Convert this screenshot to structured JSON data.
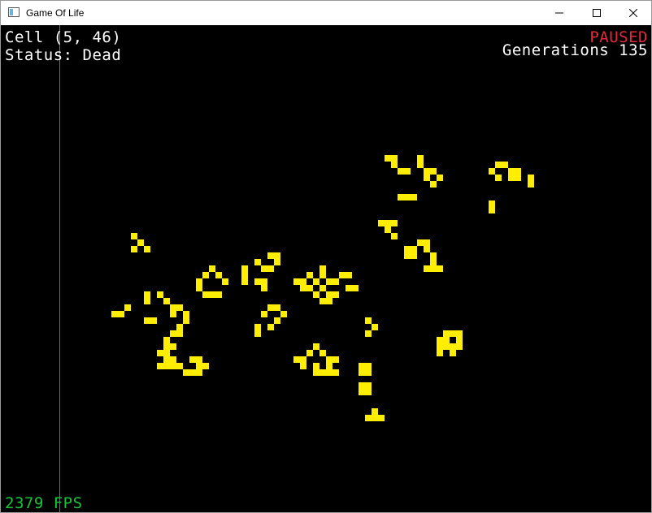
{
  "window": {
    "title": "Game Of Life",
    "controls": [
      "minimize",
      "maximize",
      "close"
    ]
  },
  "hud": {
    "cell_label": "Cell (5, 46)",
    "status_label": "Status: Dead",
    "state": "PAUSED",
    "generations": "Generations 135",
    "fps": "2379 FPS"
  },
  "board": {
    "cell_size_units": 8,
    "live_cell_color": "#ffee00",
    "dead_color": "#000000",
    "live_cells": [
      [
        59,
        20
      ],
      [
        60,
        20
      ],
      [
        64,
        20
      ],
      [
        60,
        21
      ],
      [
        64,
        21
      ],
      [
        61,
        22
      ],
      [
        62,
        22
      ],
      [
        65,
        22
      ],
      [
        66,
        22
      ],
      [
        65,
        23
      ],
      [
        67,
        23
      ],
      [
        66,
        24
      ],
      [
        61,
        26
      ],
      [
        62,
        26
      ],
      [
        63,
        26
      ],
      [
        76,
        21
      ],
      [
        77,
        21
      ],
      [
        75,
        22
      ],
      [
        78,
        22
      ],
      [
        76,
        23
      ],
      [
        78,
        23
      ],
      [
        79,
        22
      ],
      [
        79,
        23
      ],
      [
        81,
        23
      ],
      [
        81,
        24
      ],
      [
        75,
        27
      ],
      [
        75,
        28
      ],
      [
        58,
        30
      ],
      [
        59,
        30
      ],
      [
        60,
        30
      ],
      [
        59,
        31
      ],
      [
        60,
        32
      ],
      [
        64,
        33
      ],
      [
        65,
        33
      ],
      [
        62,
        34
      ],
      [
        63,
        34
      ],
      [
        65,
        34
      ],
      [
        62,
        35
      ],
      [
        63,
        35
      ],
      [
        66,
        35
      ],
      [
        66,
        36
      ],
      [
        65,
        37
      ],
      [
        66,
        37
      ],
      [
        67,
        37
      ],
      [
        20,
        32
      ],
      [
        21,
        33
      ],
      [
        20,
        34
      ],
      [
        22,
        34
      ],
      [
        41,
        35
      ],
      [
        42,
        35
      ],
      [
        39,
        36
      ],
      [
        42,
        36
      ],
      [
        37,
        37
      ],
      [
        40,
        37
      ],
      [
        41,
        37
      ],
      [
        37,
        38
      ],
      [
        37,
        39
      ],
      [
        39,
        39
      ],
      [
        40,
        39
      ],
      [
        40,
        40
      ],
      [
        32,
        37
      ],
      [
        31,
        38
      ],
      [
        33,
        38
      ],
      [
        30,
        39
      ],
      [
        34,
        39
      ],
      [
        30,
        40
      ],
      [
        31,
        41
      ],
      [
        32,
        41
      ],
      [
        33,
        41
      ],
      [
        49,
        37
      ],
      [
        47,
        38
      ],
      [
        49,
        38
      ],
      [
        52,
        38
      ],
      [
        53,
        38
      ],
      [
        45,
        39
      ],
      [
        46,
        39
      ],
      [
        48,
        39
      ],
      [
        50,
        39
      ],
      [
        51,
        39
      ],
      [
        46,
        40
      ],
      [
        47,
        40
      ],
      [
        49,
        40
      ],
      [
        53,
        40
      ],
      [
        54,
        40
      ],
      [
        48,
        41
      ],
      [
        50,
        41
      ],
      [
        51,
        41
      ],
      [
        49,
        42
      ],
      [
        50,
        42
      ],
      [
        22,
        41
      ],
      [
        24,
        41
      ],
      [
        22,
        42
      ],
      [
        25,
        42
      ],
      [
        19,
        43
      ],
      [
        26,
        43
      ],
      [
        27,
        43
      ],
      [
        17,
        44
      ],
      [
        18,
        44
      ],
      [
        26,
        44
      ],
      [
        28,
        44
      ],
      [
        22,
        45
      ],
      [
        23,
        45
      ],
      [
        28,
        45
      ],
      [
        27,
        46
      ],
      [
        26,
        47
      ],
      [
        27,
        47
      ],
      [
        25,
        48
      ],
      [
        41,
        43
      ],
      [
        42,
        43
      ],
      [
        40,
        44
      ],
      [
        43,
        44
      ],
      [
        42,
        45
      ],
      [
        39,
        46
      ],
      [
        41,
        46
      ],
      [
        39,
        47
      ],
      [
        56,
        45
      ],
      [
        57,
        46
      ],
      [
        56,
        47
      ],
      [
        68,
        48
      ],
      [
        48,
        49
      ],
      [
        68,
        49
      ],
      [
        69,
        49
      ],
      [
        47,
        50
      ],
      [
        49,
        50
      ],
      [
        45,
        51
      ],
      [
        46,
        51
      ],
      [
        50,
        51
      ],
      [
        51,
        51
      ],
      [
        46,
        52
      ],
      [
        48,
        52
      ],
      [
        50,
        52
      ],
      [
        48,
        53
      ],
      [
        49,
        53
      ],
      [
        50,
        53
      ],
      [
        51,
        53
      ],
      [
        68,
        47
      ],
      [
        69,
        47
      ],
      [
        70,
        47
      ],
      [
        67,
        48
      ],
      [
        70,
        48
      ],
      [
        67,
        49
      ],
      [
        70,
        49
      ],
      [
        67,
        50
      ],
      [
        69,
        50
      ],
      [
        25,
        49
      ],
      [
        26,
        49
      ],
      [
        24,
        50
      ],
      [
        25,
        50
      ],
      [
        25,
        51
      ],
      [
        26,
        51
      ],
      [
        24,
        52
      ],
      [
        25,
        52
      ],
      [
        26,
        52
      ],
      [
        27,
        52
      ],
      [
        29,
        51
      ],
      [
        30,
        51
      ],
      [
        30,
        52
      ],
      [
        31,
        52
      ],
      [
        28,
        53
      ],
      [
        29,
        53
      ],
      [
        30,
        53
      ],
      [
        55,
        52
      ],
      [
        56,
        52
      ],
      [
        55,
        53
      ],
      [
        56,
        53
      ],
      [
        55,
        55
      ],
      [
        56,
        55
      ],
      [
        55,
        56
      ],
      [
        56,
        56
      ],
      [
        57,
        59
      ],
      [
        56,
        60
      ],
      [
        57,
        60
      ],
      [
        58,
        60
      ]
    ]
  }
}
